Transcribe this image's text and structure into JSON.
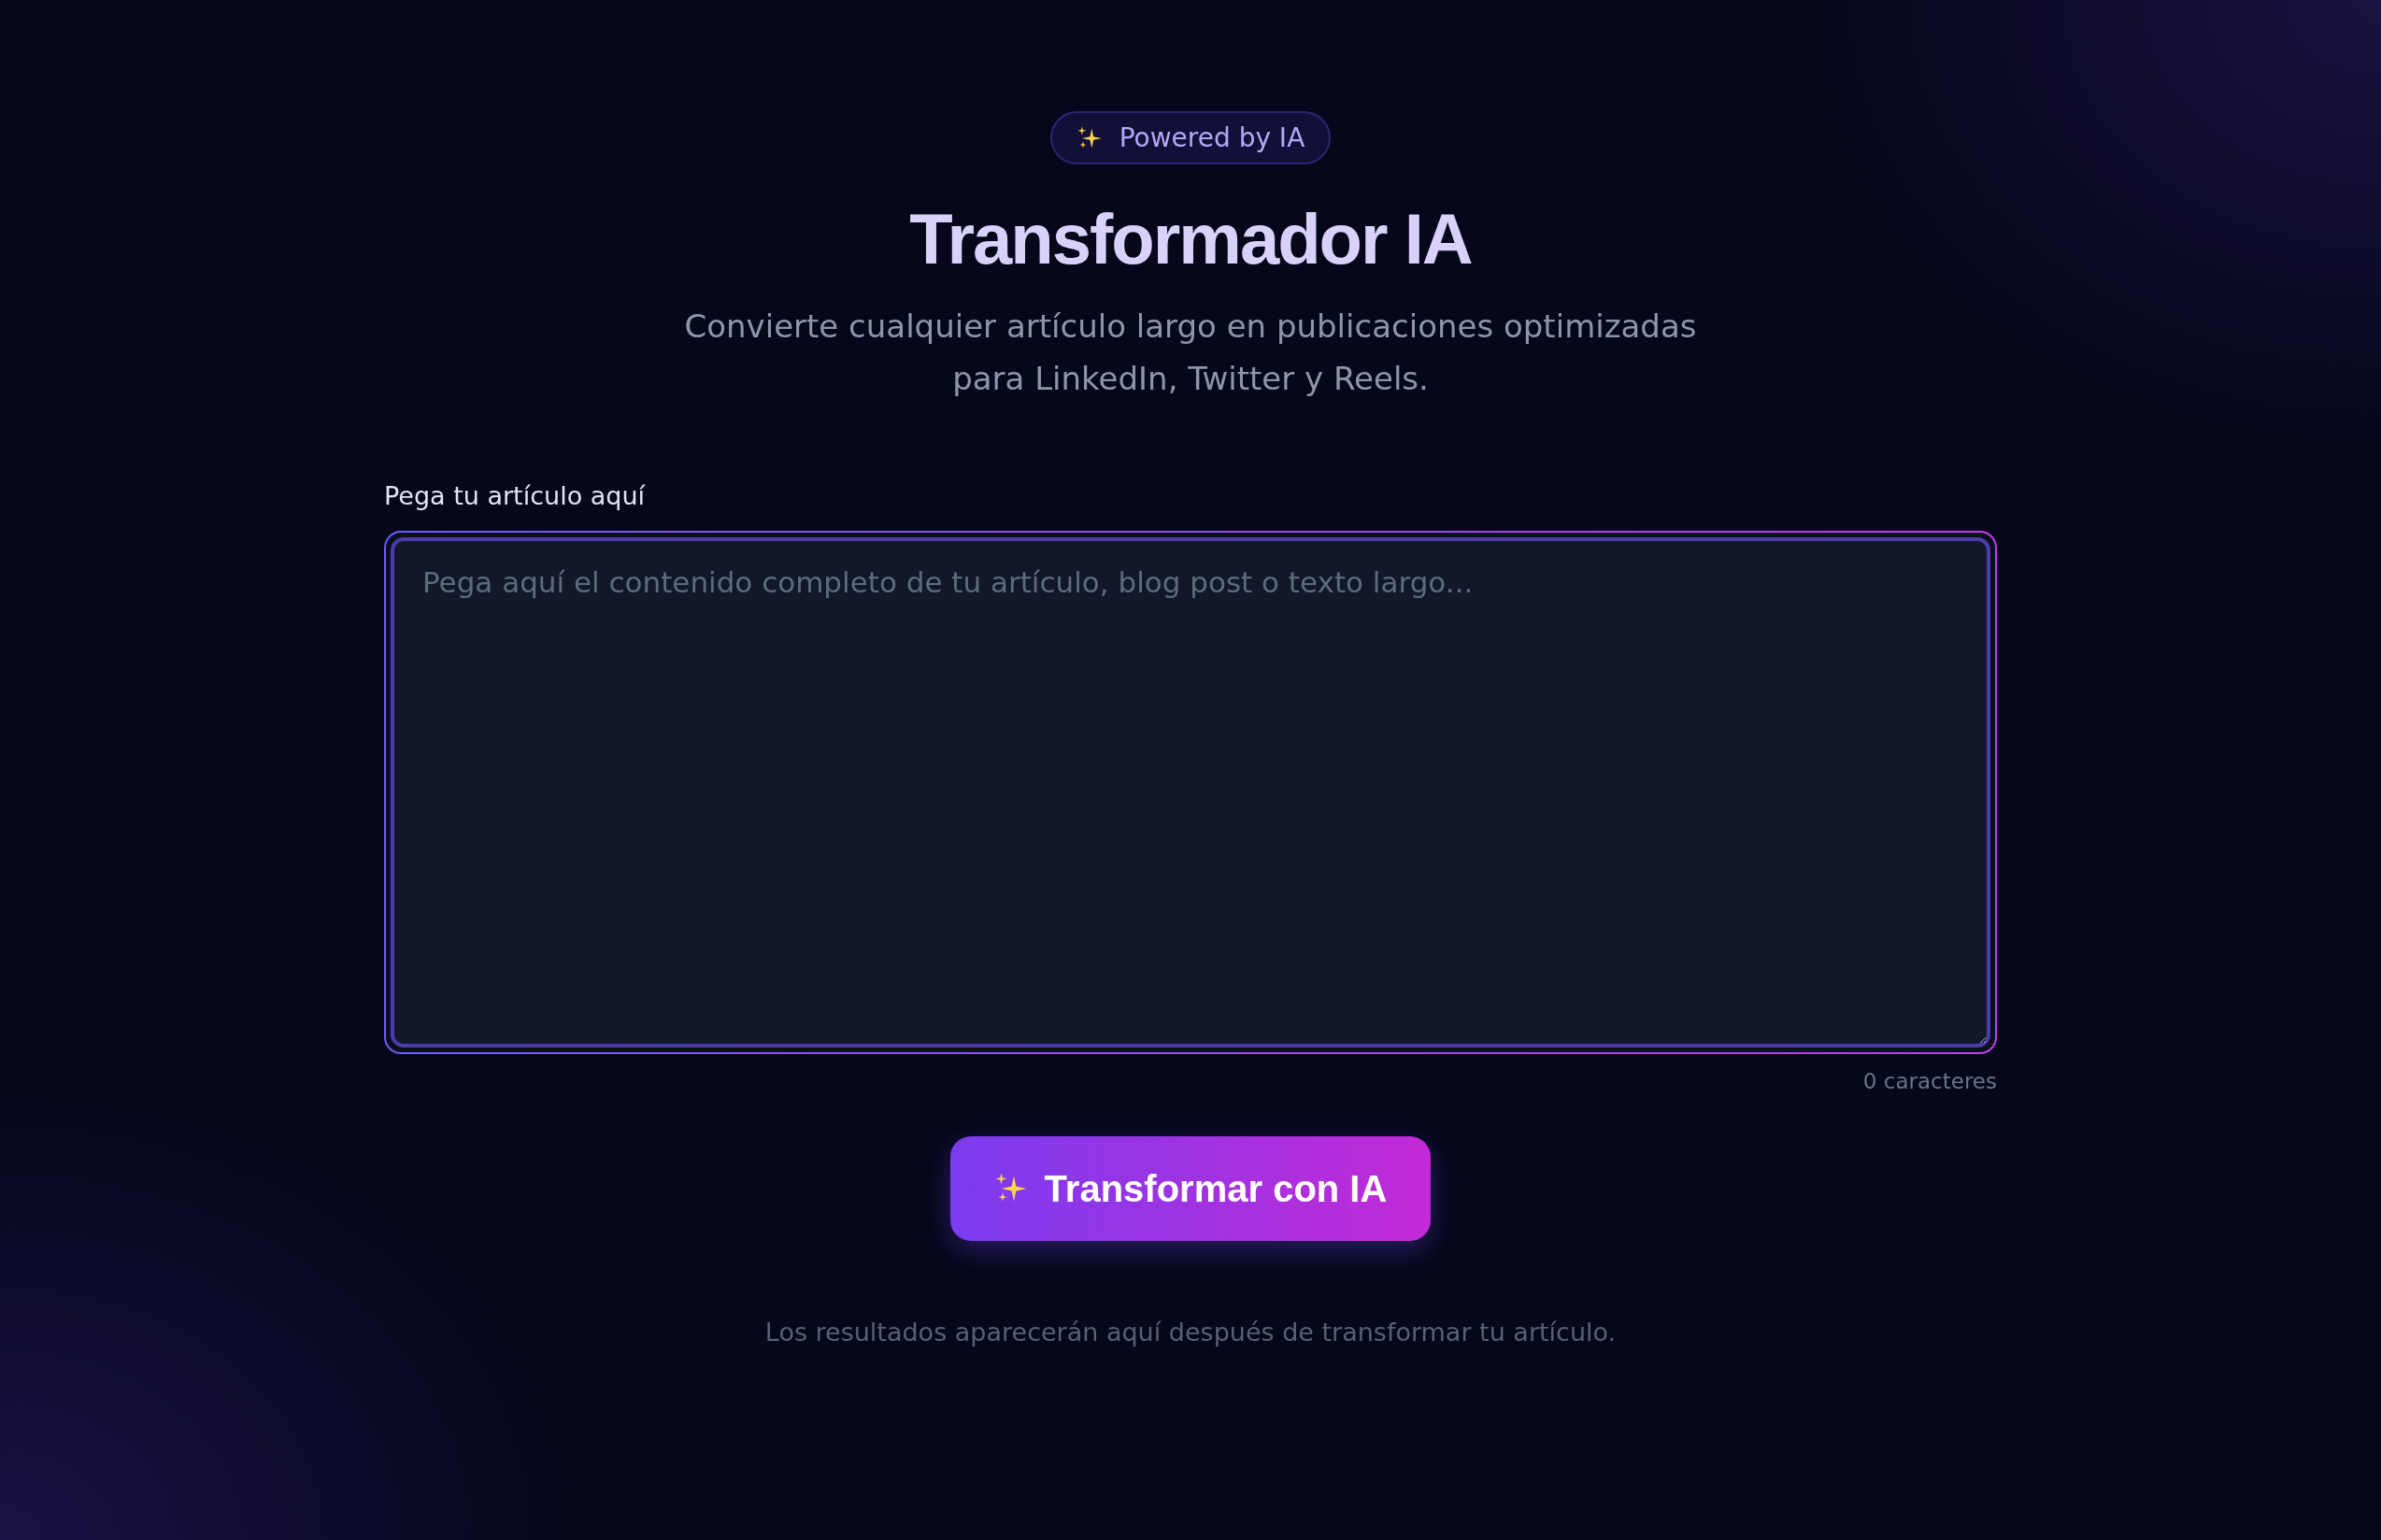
{
  "badge": {
    "text": "Powered by IA"
  },
  "title": "Transformador IA",
  "subtitle": "Convierte cualquier artículo largo en publicaciones optimizadas para LinkedIn, Twitter y Reels.",
  "article_field": {
    "label": "Pega tu artículo aquí",
    "placeholder": "Pega aquí el contenido completo de tu artículo, blog post o texto largo...",
    "counter": "0 caracteres"
  },
  "submit_button": {
    "label": "Transformar con IA"
  },
  "results_hint": "Los resultados aparecerán aquí después de transformar tu artículo."
}
